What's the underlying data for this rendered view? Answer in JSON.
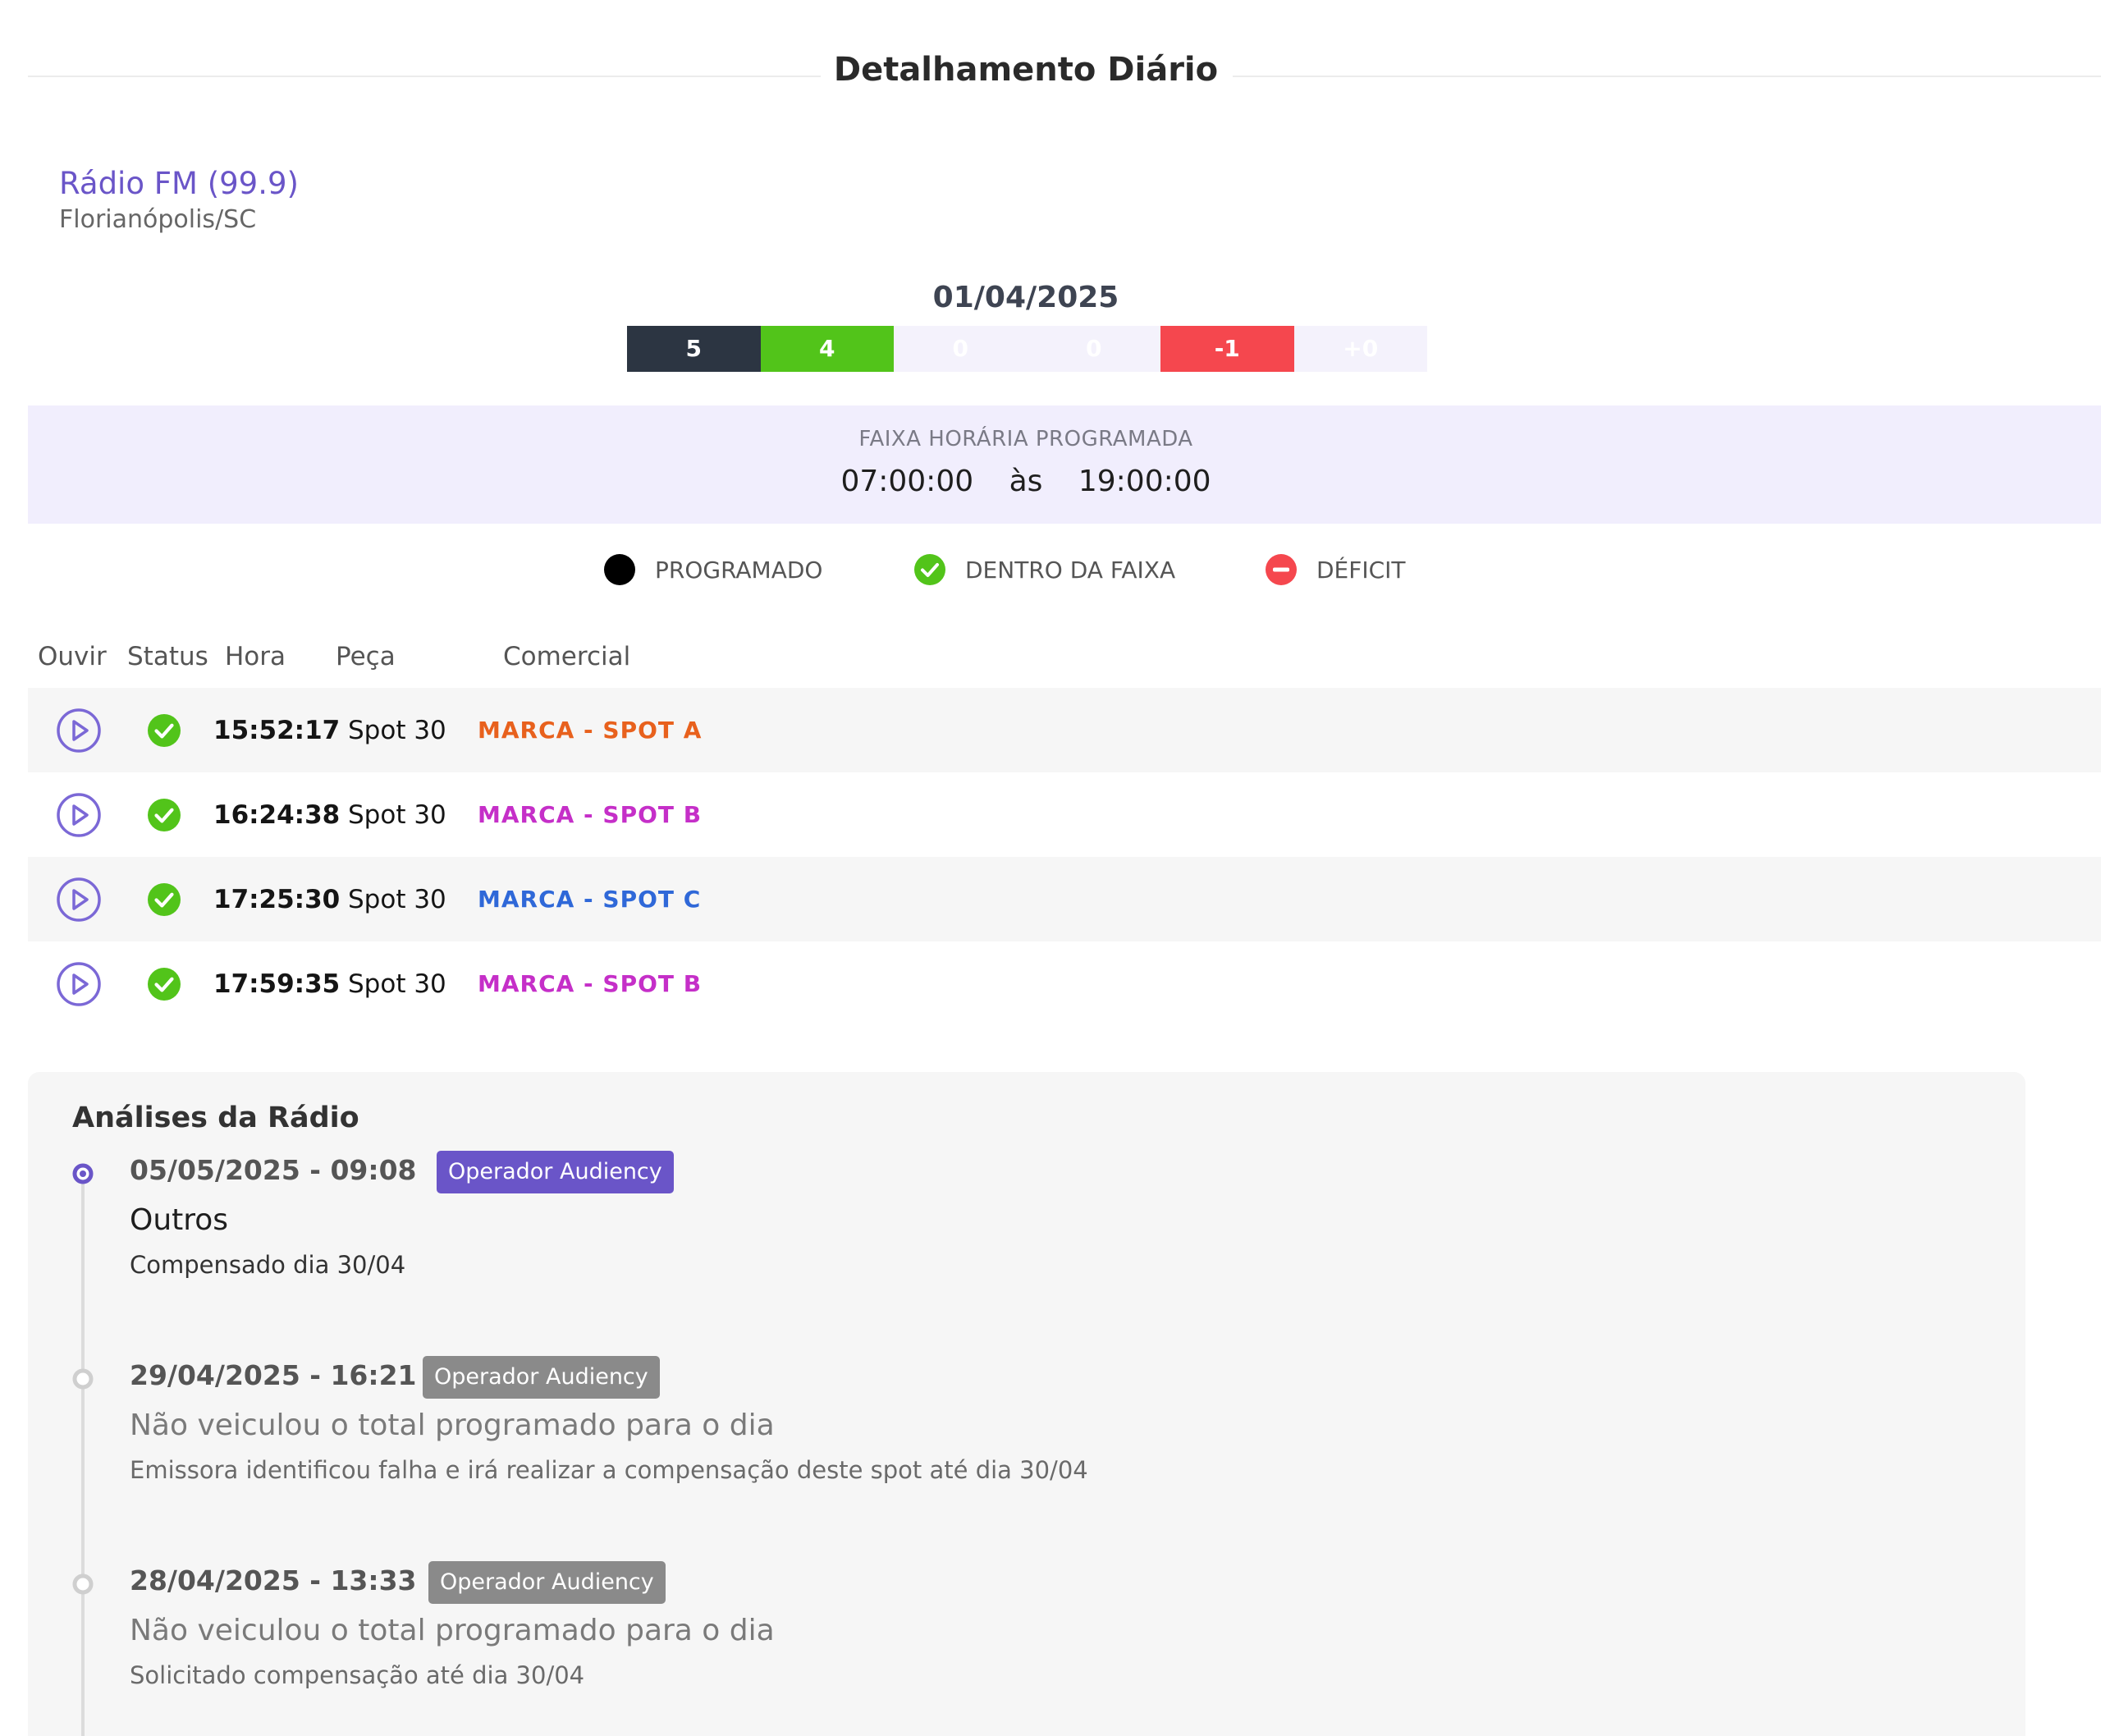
{
  "header": {
    "title": "Detalhamento Diário"
  },
  "station": {
    "name": "Rádio FM (99.9)",
    "city": "Florianópolis/SC"
  },
  "summary": {
    "date": "01/04/2025",
    "segments": [
      {
        "value": "5",
        "bg": "#2c3542",
        "fg": "#ffffff"
      },
      {
        "value": "4",
        "bg": "#52c41a",
        "fg": "#ffffff"
      },
      {
        "value": "0",
        "bg": "#f4f2fc",
        "fg": "#ffffff"
      },
      {
        "value": "0",
        "bg": "#f4f2fc",
        "fg": "#ffffff"
      },
      {
        "value": "-1",
        "bg": "#f5474e",
        "fg": "#ffffff"
      },
      {
        "value": "+0",
        "bg": "#f4f2fc",
        "fg": "#ffffff"
      }
    ]
  },
  "time_window": {
    "label": "FAIXA HORÁRIA PROGRAMADA",
    "start": "07:00:00",
    "separator": "às",
    "end": "19:00:00"
  },
  "legend": {
    "programado": "PROGRAMADO",
    "dentro": "DENTRO DA FAIXA",
    "deficit": "DÉFICIT"
  },
  "table": {
    "headers": {
      "ouvir": "Ouvir",
      "status": "Status",
      "hora": "Hora",
      "peca": "Peça",
      "comercial": "Comercial"
    },
    "rows": [
      {
        "hora": "15:52:17",
        "peca": "Spot 30",
        "comercial": "MARCA - SPOT A",
        "color": "#e8611d"
      },
      {
        "hora": "16:24:38",
        "peca": "Spot 30",
        "comercial": "MARCA - SPOT B",
        "color": "#c52fc8"
      },
      {
        "hora": "17:25:30",
        "peca": "Spot 30",
        "comercial": "MARCA - SPOT C",
        "color": "#2f68d8"
      },
      {
        "hora": "17:59:35",
        "peca": "Spot 30",
        "comercial": "MARCA - SPOT B",
        "color": "#c52fc8"
      }
    ]
  },
  "analyses": {
    "title": "Análises da Rádio",
    "entries": [
      {
        "date": "05/05/2025 - 09:08",
        "badge": "Operador Audiency",
        "title": "Outros",
        "desc": "Compensado dia 30/04",
        "active": true
      },
      {
        "date": "29/04/2025 - 16:21",
        "badge": "Operador Audiency",
        "title": "Não veiculou o total programado para o dia",
        "desc": "Emissora identificou falha e irá realizar a compensação deste spot até dia 30/04",
        "active": false
      },
      {
        "date": "28/04/2025 - 13:33",
        "badge": "Operador Audiency",
        "title": "Não veiculou o total programado para o dia",
        "desc": "Solicitado compensação até dia 30/04",
        "active": false
      }
    ]
  },
  "colors": {
    "accent": "#6a55c8",
    "success": "#52c41a",
    "danger": "#f5474e",
    "muted_badge": "#8a8a8a"
  }
}
